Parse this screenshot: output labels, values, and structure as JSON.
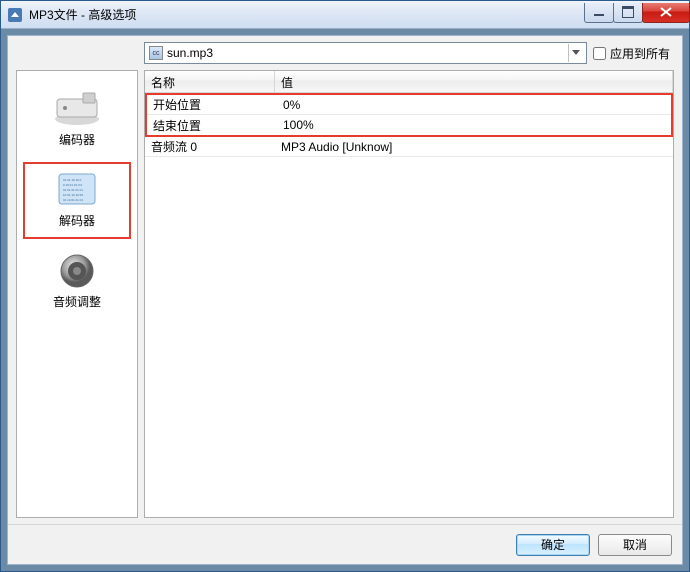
{
  "window": {
    "title": "MP3文件 - 高级选项"
  },
  "top": {
    "filename": "sun.mp3",
    "apply_all_label": "应用到所有"
  },
  "sidebar": {
    "items": [
      {
        "label": "编码器"
      },
      {
        "label": "解码器"
      },
      {
        "label": "音频调整"
      }
    ]
  },
  "table": {
    "header_name": "名称",
    "header_value": "值",
    "rows": [
      {
        "name": "开始位置",
        "value": "0%"
      },
      {
        "name": "结束位置",
        "value": "100%"
      },
      {
        "name": "音频流 0",
        "value": "MP3 Audio [Unknow]"
      }
    ]
  },
  "footer": {
    "ok_label": "确定",
    "cancel_label": "取消"
  }
}
